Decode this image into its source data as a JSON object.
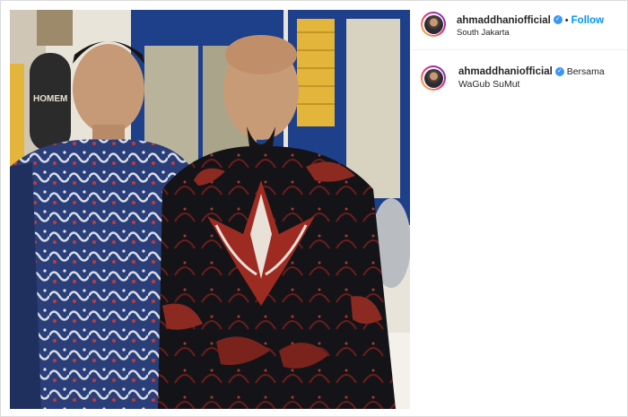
{
  "post": {
    "username": "ahmaddhaniofficial",
    "verified_icon": "verified-badge-icon",
    "separator": "•",
    "follow_label": "Follow",
    "location": "South Jakarta"
  },
  "caption": {
    "username": "ahmaddhaniofficial",
    "text": "Bersama WaGub SuMut"
  },
  "colors": {
    "follow": "#0095f6",
    "verified": "#3897f0",
    "border": "#dbdbdb"
  }
}
